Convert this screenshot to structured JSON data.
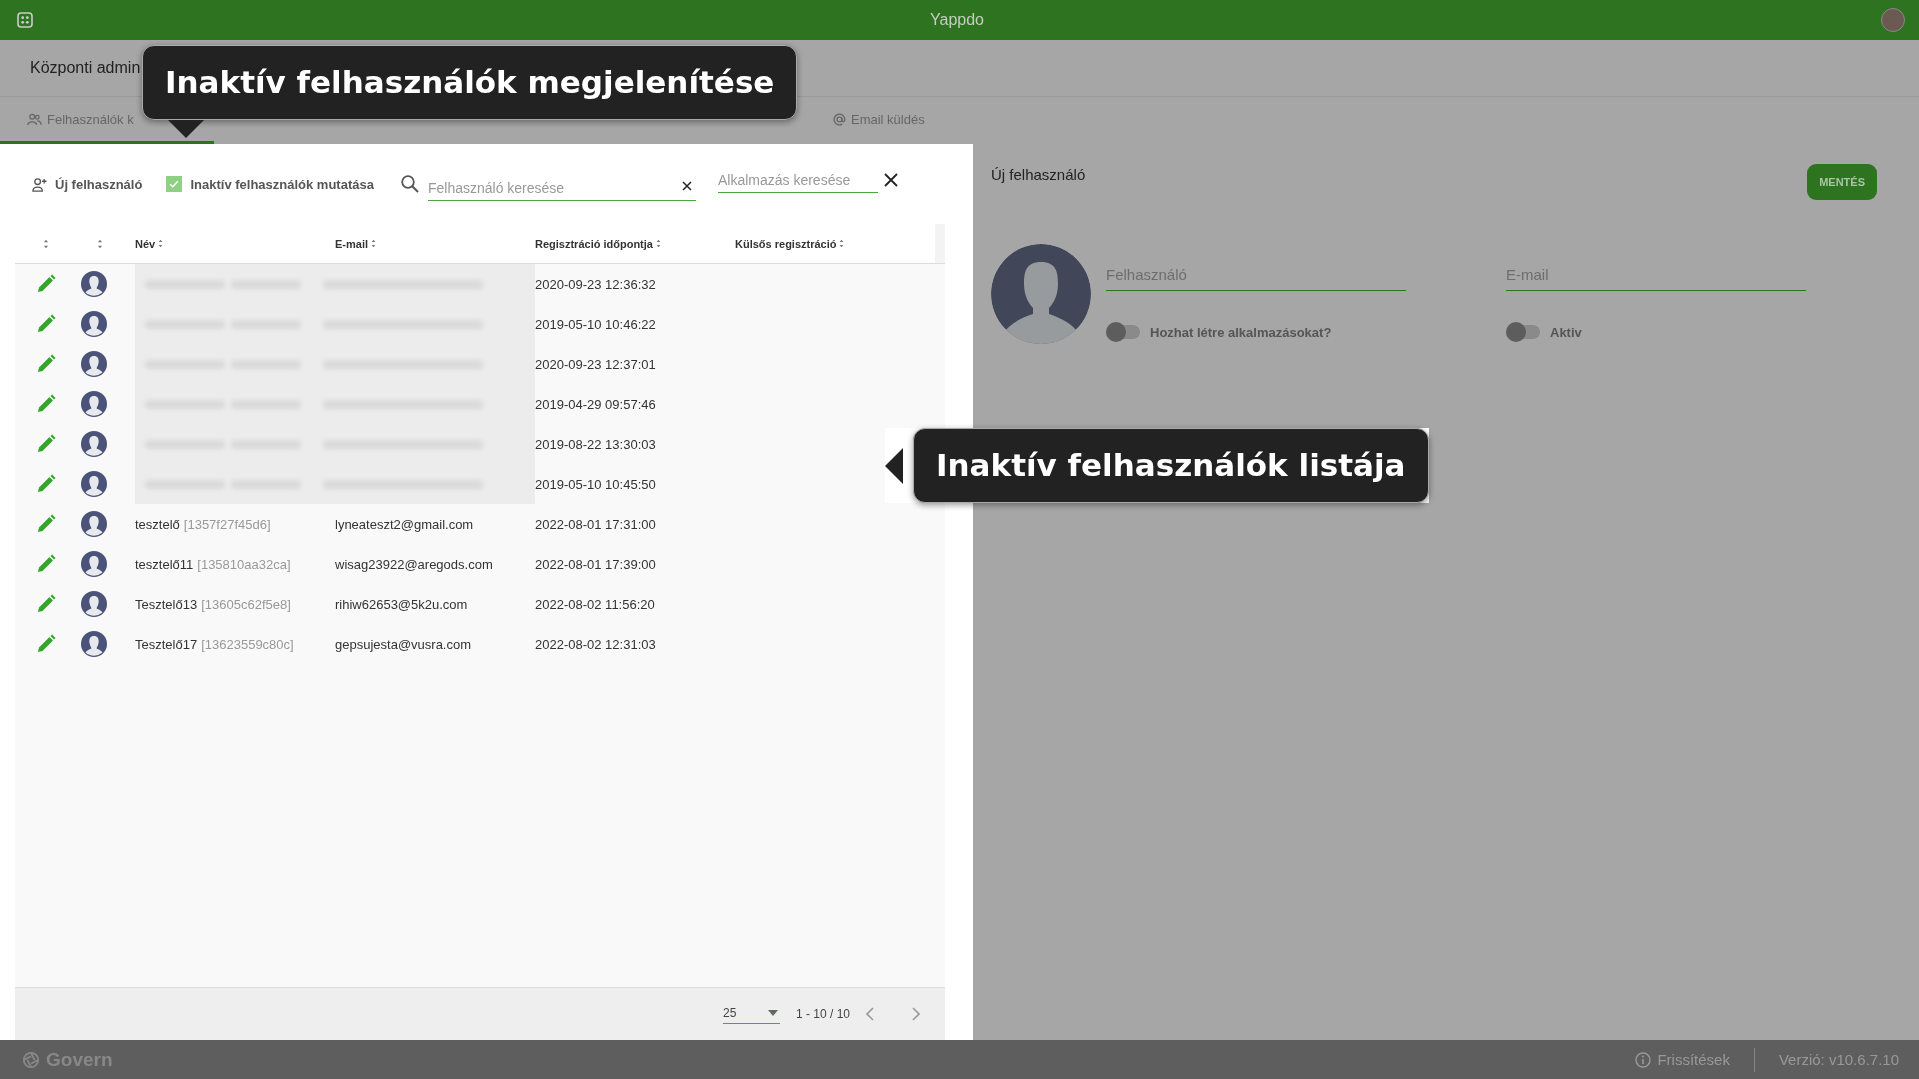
{
  "top_bar": {
    "title": "Yappdo"
  },
  "header": {
    "title": "Központi admin"
  },
  "tabs": [
    {
      "label": "Felhasználók k",
      "selected": true
    },
    {
      "label": "Email küldés",
      "selected": false
    }
  ],
  "toolbar": {
    "new_user": "Új felhasználó",
    "inactive_toggle": {
      "label": "Inaktív felhasználók mutatása",
      "checked": true
    },
    "user_search": {
      "placeholder": "Felhasználó keresése"
    },
    "app_search": {
      "placeholder": "Alkalmazás keresése"
    }
  },
  "table": {
    "columns": [
      "Név",
      "E-mail",
      "Regisztráció időpontja",
      "Külsős regisztráció"
    ],
    "rows": [
      {
        "blurred": true,
        "registered": "2020-09-23 12:36:32"
      },
      {
        "blurred": true,
        "registered": "2019-05-10 10:46:22"
      },
      {
        "blurred": true,
        "registered": "2020-09-23 12:37:01"
      },
      {
        "blurred": true,
        "registered": "2019-04-29 09:57:46"
      },
      {
        "blurred": true,
        "registered": "2019-08-22 13:30:03"
      },
      {
        "blurred": true,
        "registered": "2019-05-10 10:45:50"
      },
      {
        "blurred": false,
        "name": "tesztelő",
        "id": "[1357f27f45d6]",
        "email": "lyneateszt2@gmail.com",
        "registered": "2022-08-01 17:31:00"
      },
      {
        "blurred": false,
        "name": "tesztelő11",
        "id": "[135810aa32ca]",
        "email": "wisag23922@aregods.com",
        "registered": "2022-08-01 17:39:00"
      },
      {
        "blurred": false,
        "name": "Tesztelő13",
        "id": "[13605c62f5e8]",
        "email": "rihiw62653@5k2u.com",
        "registered": "2022-08-02 11:56:20"
      },
      {
        "blurred": false,
        "name": "Tesztelő17",
        "id": "[13623559c80c]",
        "email": "gepsujesta@vusra.com",
        "registered": "2022-08-02 12:31:03"
      }
    ]
  },
  "pagination": {
    "page_size": "25",
    "range": "1 - 10 / 10"
  },
  "detail": {
    "title": "Új felhasználó",
    "save": "MENTÉS",
    "fields": [
      {
        "placeholder": "Felhasználó"
      },
      {
        "placeholder": "E-mail"
      }
    ],
    "switches": [
      {
        "label": "Hozhat létre alkalmazásokat?",
        "on": false
      },
      {
        "label": "Aktiv",
        "on": false
      }
    ]
  },
  "footer": {
    "brand": "Govern",
    "updates": "Frissítések",
    "version": "Verzió: v10.6.7.10"
  },
  "callouts": [
    {
      "text": "Inaktív felhasználók megjelenítése",
      "kind": "below"
    },
    {
      "text": "Inaktív felhasználók listája",
      "kind": "side"
    }
  ]
}
